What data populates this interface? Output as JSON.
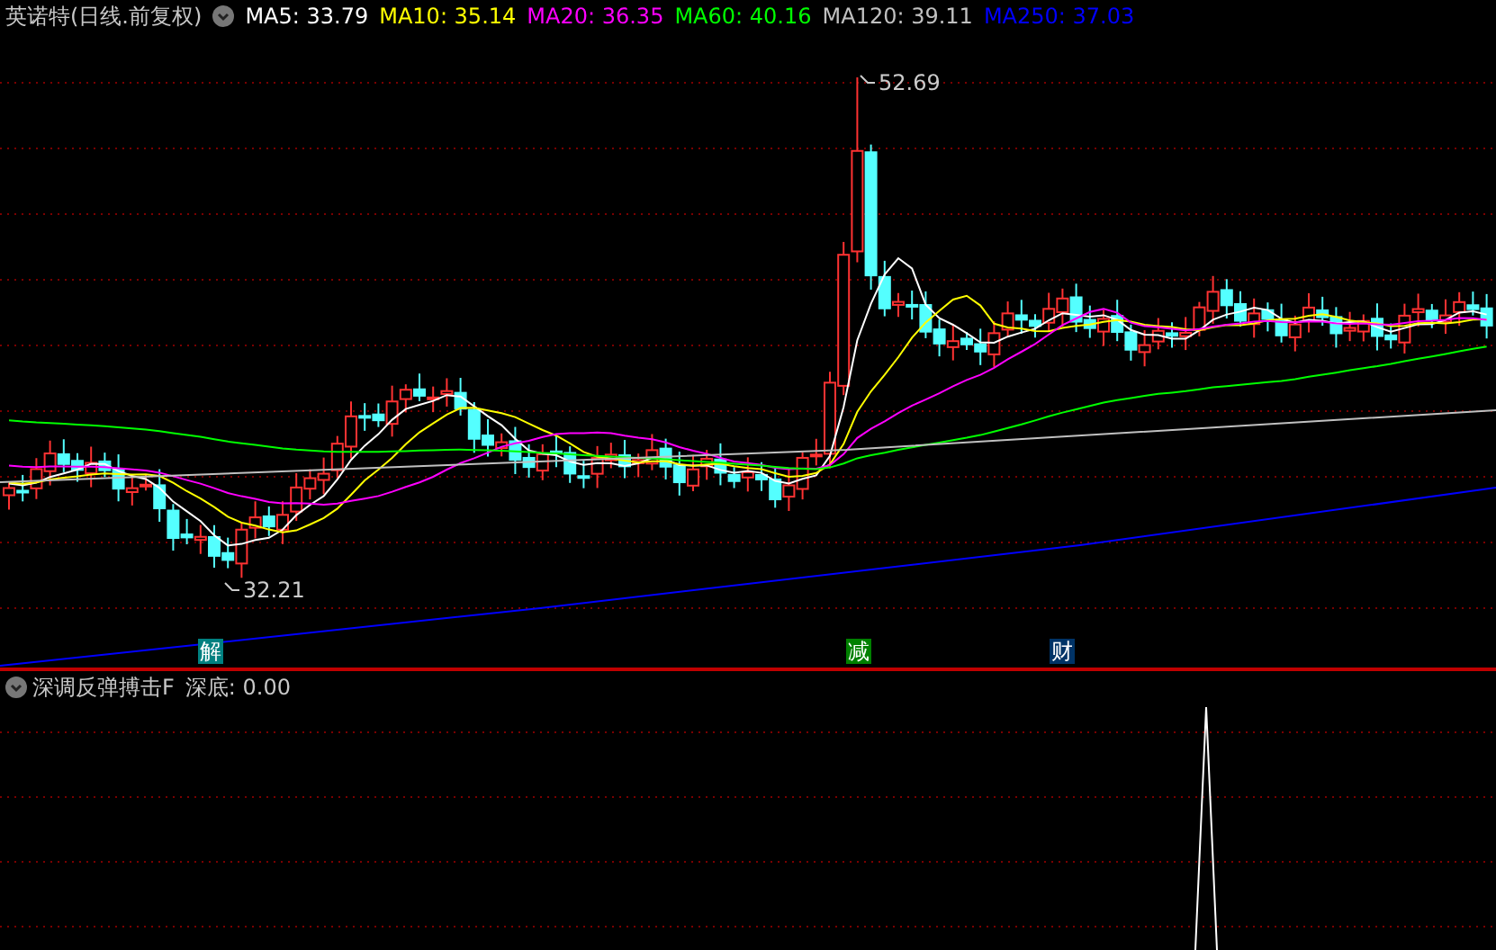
{
  "header": {
    "title": "英诺特(日线.前复权)",
    "ma_items": [
      {
        "label": "MA5: 33.79",
        "color": "#ffffff"
      },
      {
        "label": "MA10: 35.14",
        "color": "#ffff00"
      },
      {
        "label": "MA20: 36.35",
        "color": "#ff00ff"
      },
      {
        "label": "MA60: 40.16",
        "color": "#00ff00"
      },
      {
        "label": "MA120: 39.11",
        "color": "#c0c0c0"
      },
      {
        "label": "MA250: 37.03",
        "color": "#0000ff"
      }
    ]
  },
  "price_marks": [
    {
      "text": "52.69",
      "kind": "high"
    },
    {
      "text": "32.21",
      "kind": "low"
    }
  ],
  "event_tags": [
    {
      "text": "解",
      "color": "#008080"
    },
    {
      "text": "减",
      "color": "#008000"
    },
    {
      "text": "财",
      "color": "#003366"
    }
  ],
  "indicator": {
    "title": "深调反弹搏击F",
    "reading": "深底: 0.00"
  }
}
